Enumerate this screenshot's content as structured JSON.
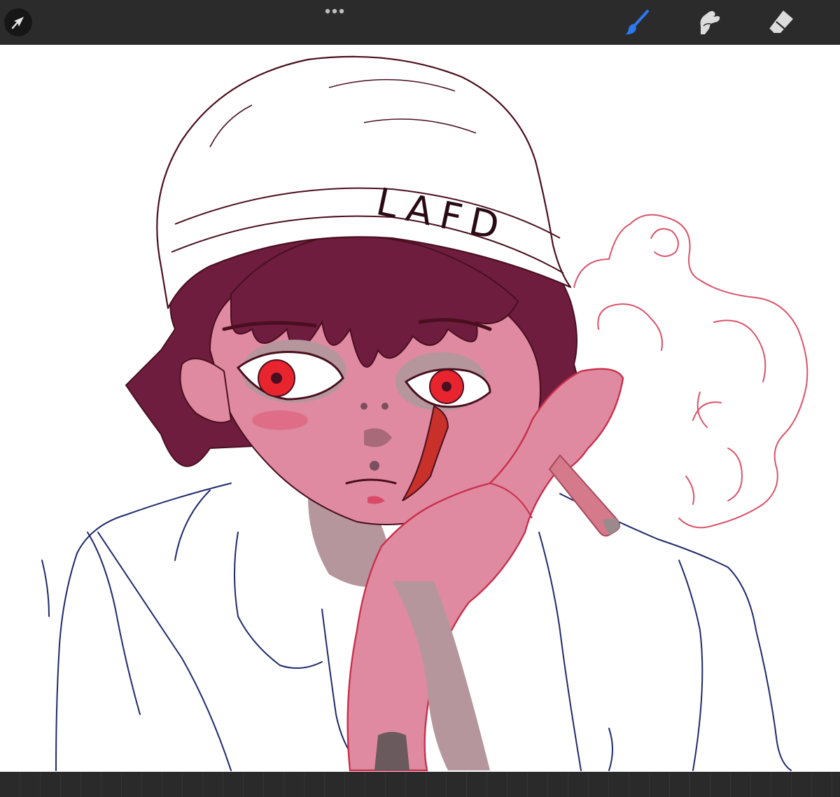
{
  "app": {
    "name": "Procreate"
  },
  "toolbar": {
    "left_tools": [
      {
        "name": "actions",
        "icon": "arrow-cursor-icon"
      },
      {
        "name": "more",
        "icon": "more-dots-icon"
      }
    ],
    "right_tools": [
      {
        "name": "brush",
        "icon": "brush-icon",
        "active": true
      },
      {
        "name": "smudge",
        "icon": "smudge-finger-icon",
        "active": false
      },
      {
        "name": "eraser",
        "icon": "eraser-icon",
        "active": false
      }
    ],
    "active_color": "#2b78f0",
    "inactive_color": "#dcdcdc",
    "background": "#2b2b2b"
  },
  "canvas": {
    "artwork": {
      "beanie_text": "LAFD"
    },
    "colors": {
      "hair": "#6e1d3e",
      "skin": "#df8aa0",
      "skin_shadow": "#b5969c",
      "eyes": "#e8242e",
      "line_dark": "#4a0f1f",
      "shirt_line": "#1f2a6a",
      "smoke_line": "#d8546a",
      "scar": "#c8302a"
    }
  }
}
